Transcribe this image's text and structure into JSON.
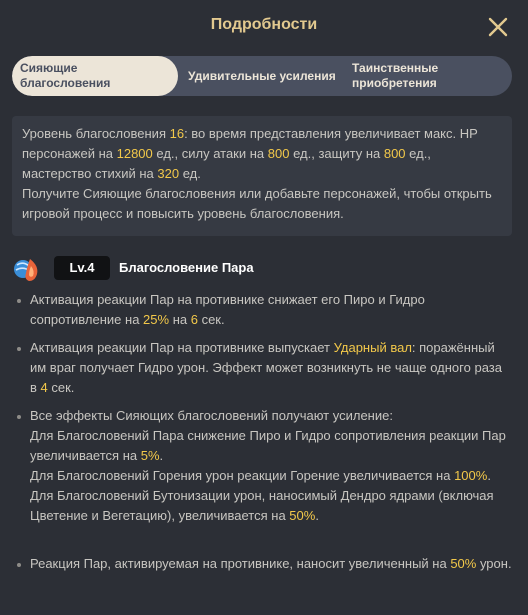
{
  "header": {
    "title": "Подробности",
    "close_icon": "close-icon"
  },
  "tabs": [
    {
      "line1": "Сияющие",
      "line2": "благословения",
      "active": true
    },
    {
      "line1": "Удивительные усиления",
      "line2": "",
      "active": false
    },
    {
      "line1": "Таинственные",
      "line2": "приобретения",
      "active": false
    }
  ],
  "intro": {
    "p1": "Уровень благословения ",
    "level": "16",
    "p2": ": во время представления увеличивает макс. HP персонажей на ",
    "hp": "12800",
    "p3": " ед., силу атаки на ",
    "atk": "800",
    "p4": " ед., защиту на ",
    "def": "800",
    "p5": " ед., мастерство стихий на ",
    "em": "320",
    "p6": " ед.",
    "p7": "Получите Сияющие благословения или добавьте персонажей, чтобы открыть игровой процесс и повысить уровень благословения."
  },
  "blessing": {
    "icon": "vaporize-blessing-icon",
    "level": "Lv.4",
    "name": "Благословение Пара"
  },
  "effects": {
    "e1": {
      "a": "Активация реакции Пар на противнике снижает его Пиро и Гидро сопротивление на ",
      "v1": "25%",
      "b": " на ",
      "v2": "6",
      "c": " сек."
    },
    "e2": {
      "a": "Активация реакции Пар на противнике выпускает ",
      "v1": "Ударный вал",
      "b": ": поражённый им враг получает Гидро урон. Эффект может возникнуть не чаще одного раза в ",
      "v2": "4",
      "c": " сек."
    },
    "e3": {
      "head": "Все эффекты Сияющих благословений получают усиление:",
      "l1a": "Для Благословений Пара снижение Пиро и Гидро сопротивления реакции Пар увеличивается на ",
      "l1v": "5%",
      "l1b": ".",
      "l2a": "Для Благословений Горения урон реакции Горение увеличивается на ",
      "l2v": "100%",
      "l2b": ".",
      "l3a": "Для Благословений Бутонизации урон, наносимый Дендро ядрами (включая Цветение и Вегетацию), увеличивается на ",
      "l3v": "50%",
      "l3b": "."
    },
    "e4": {
      "a": "Реакция Пар, активируемая на противнике, наносит увеличенный на ",
      "v1": "50%",
      "b": " урон."
    }
  },
  "colors": {
    "highlight": "#f2c84a",
    "title": "#e2c98f",
    "panel": "#2c2f36"
  }
}
